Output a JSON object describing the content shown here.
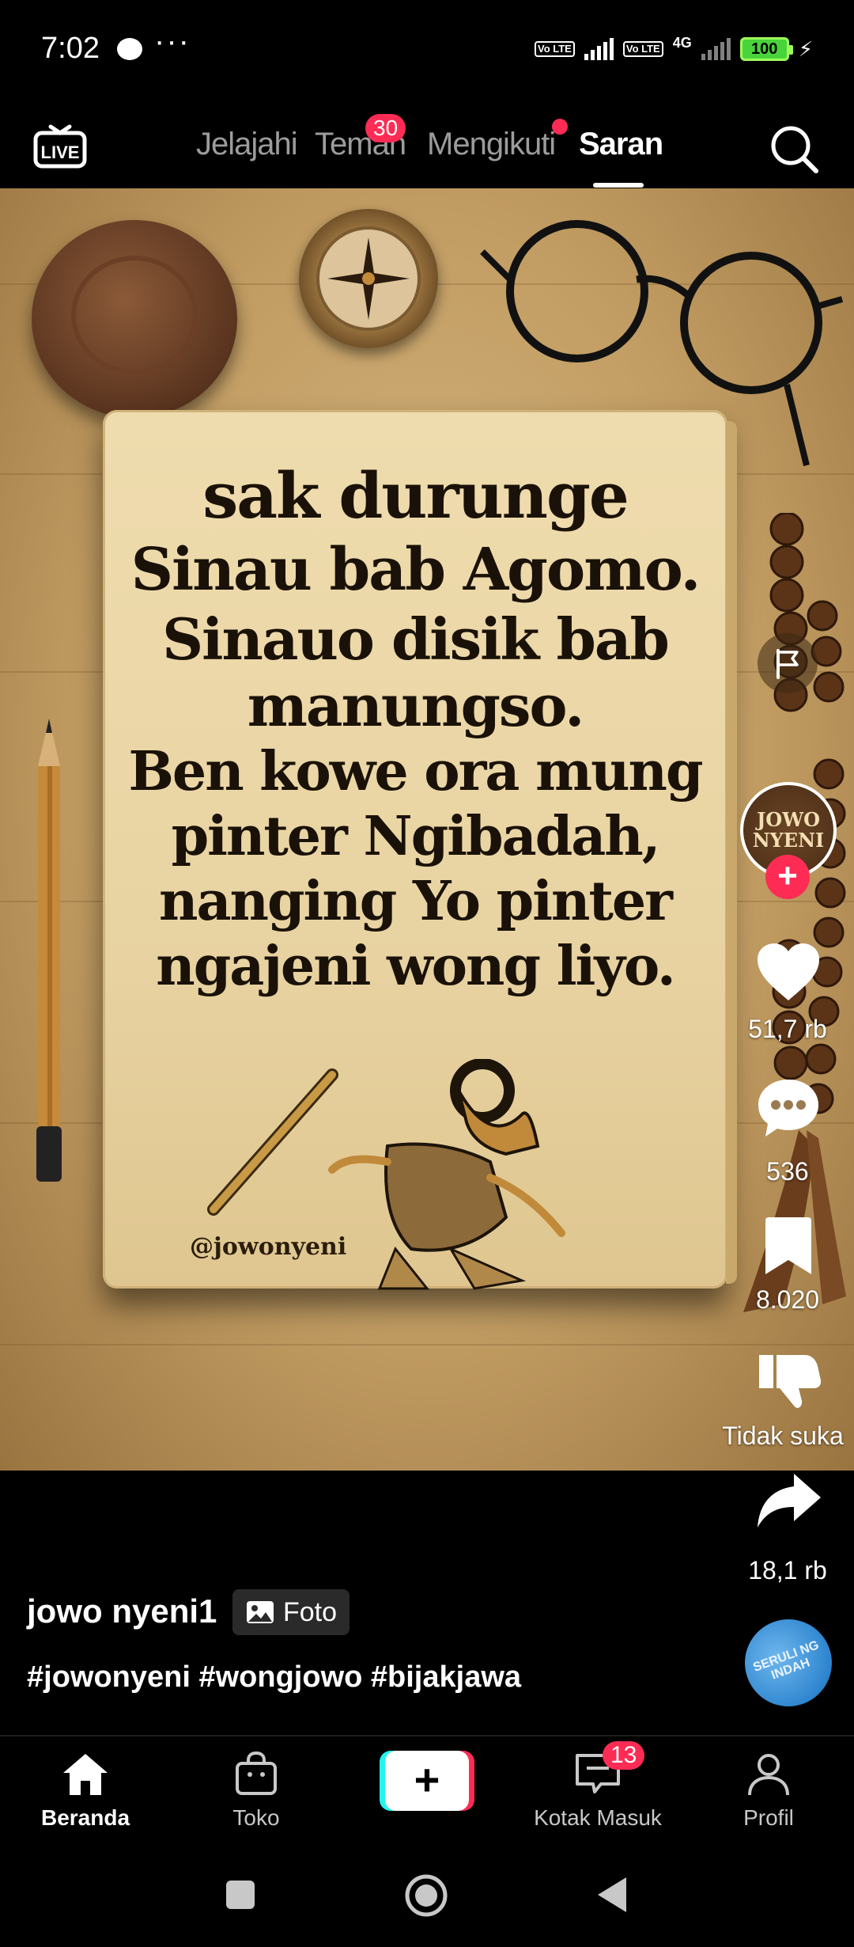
{
  "status_bar": {
    "time": "7:02",
    "more_indicator": "···",
    "volte_1": "Vo LTE",
    "volte_2": "Vo LTE",
    "network": "4G",
    "battery": "100"
  },
  "top_nav": {
    "live_label": "LIVE",
    "tabs": [
      {
        "label": "Jelajahi"
      },
      {
        "label": "Teman",
        "badge": "30"
      },
      {
        "label": "Mengikuti"
      },
      {
        "label": "Saran",
        "active": true
      }
    ]
  },
  "post": {
    "quote_lines": [
      "sak durunge",
      "Sinau bab Agomo.",
      "Sinauo disik bab",
      "manungso.",
      "Ben kowe ora mung",
      "pinter Ngibadah,",
      "nanging Yo pinter",
      "ngajeni wong liyo."
    ],
    "handle": "@jowonyeni"
  },
  "actions": {
    "avatar_text_line1": "JOWO",
    "avatar_text_line2": "NYENI",
    "likes": "51,7 rb",
    "comments": "536",
    "saves": "8.020",
    "dislike_label": "Tidak suka",
    "shares": "18,1 rb"
  },
  "caption": {
    "username": "jowo nyeni1",
    "type_badge": "Foto",
    "hashtags": "#jowonyeni #wongjowo #bijakjawa",
    "music_disc_text": "SERULI NG INDAH"
  },
  "bottom_nav": {
    "items": [
      {
        "label": "Beranda",
        "active": true
      },
      {
        "label": "Toko"
      },
      {
        "label": "Kotak Masuk",
        "badge": "13"
      },
      {
        "label": "Profil"
      }
    ]
  },
  "colors": {
    "accent": "#fe2c55",
    "cyan": "#25f4ee",
    "background": "#000000"
  }
}
